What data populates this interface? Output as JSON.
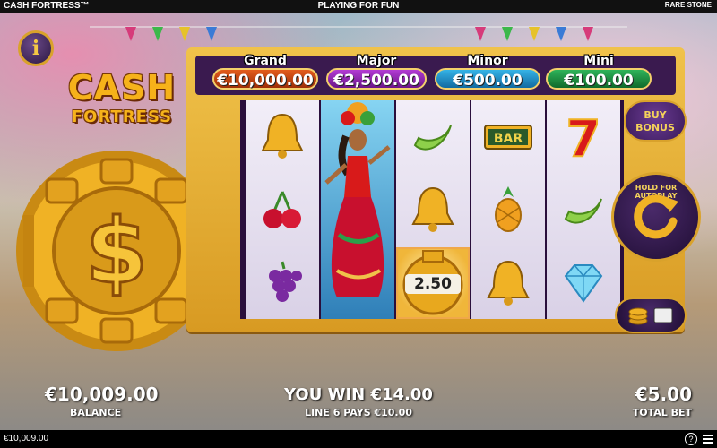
{
  "topbar": {
    "title": "CASH FORTRESS™",
    "mode": "PLAYING FOR FUN",
    "brand": "RARE STONE"
  },
  "info_icon": "info-icon",
  "logo": {
    "line1": "CASH",
    "line2": "FORTRESS"
  },
  "jackpots": [
    {
      "name": "Grand",
      "value": "€10,000.00",
      "color": "#d2561a"
    },
    {
      "name": "Major",
      "value": "€2,500.00",
      "color": "#9d2ac0"
    },
    {
      "name": "Minor",
      "value": "€500.00",
      "color": "#2a9dd6"
    },
    {
      "name": "Mini",
      "value": "€100.00",
      "color": "#2aa14c"
    }
  ],
  "reels": [
    [
      "bell",
      "cherries",
      "grapes"
    ],
    [
      "wild-dancer",
      "wild-dancer",
      "wild-dancer"
    ],
    [
      "banana",
      "bell",
      "coin"
    ],
    [
      "bar",
      "pineapple",
      "bell"
    ],
    [
      "seven",
      "banana",
      "diamond"
    ]
  ],
  "symbols": {
    "bar_text": "BAR",
    "seven_text": "7"
  },
  "coin_value": "2.50",
  "controls": {
    "buy_bonus_line1": "BUY",
    "buy_bonus_line2": "BONUS",
    "autoplay_label": "HOLD FOR AUTOPLAY"
  },
  "bottom": {
    "balance_value": "€10,009.00",
    "balance_label": "BALANCE",
    "win_text": "YOU WIN €14.00",
    "win_sub": "LINE 6 PAYS €10.00",
    "bet_value": "€5.00",
    "bet_label": "TOTAL BET"
  },
  "footer": {
    "balance": "€10,009.00",
    "help": "?"
  }
}
